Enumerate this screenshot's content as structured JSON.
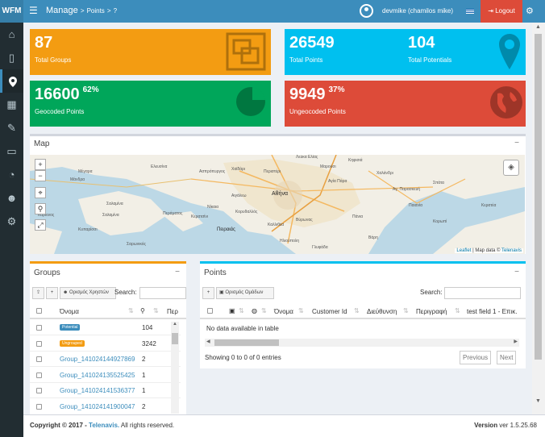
{
  "header": {
    "brand": "WFM",
    "title": "Manage",
    "crumb_sep1": ">",
    "crumb_item": "Points",
    "crumb_sep2": ">",
    "crumb_q": "?",
    "user": "devmike (chamilos mike)",
    "logout_label": "Logout"
  },
  "stats": {
    "groups": {
      "value": "87",
      "label": "Total Groups"
    },
    "points": {
      "value": "26549",
      "label": "Total Points"
    },
    "potentials": {
      "value": "104",
      "label": "Total Potentials"
    },
    "geocoded": {
      "value": "16600",
      "pct": "62%",
      "label": "Geocoded Points"
    },
    "ungeocoded": {
      "value": "9949",
      "pct": "37%",
      "label": "Ungeocoded Points"
    }
  },
  "map_panel": {
    "title": "Map",
    "minimize": "−",
    "zoom_in": "+",
    "zoom_out": "−",
    "attribution_leaflet": "Leaflet",
    "attribution_sep": " | Map data © ",
    "attribution_provider": "Telenavis",
    "labels": {
      "l1": "Λεύκα Ελίας",
      "l2": "Κηφισιά",
      "l3": "Σπάτα",
      "l4": "Μαρούσι",
      "l5": "Αγία Πάρα",
      "l6": "Χαϊδάρι",
      "l7": "Περιστέρι",
      "l8": "Αθήνα",
      "l9": "Αιγάλεω",
      "l10": "Κορυδαλλός",
      "l11": "Πειραιάς",
      "l12": "Νίκαια",
      "l13": "Σαλαμίνα",
      "l14": "Περάματος",
      "l15": "Καλλιθέα",
      "l16": "Βύρωνας",
      "l17": "Ηλιούπολη",
      "l18": "Γλυφάδα",
      "l19": "Κερατέα",
      "l20": "Σαρωνικός",
      "l21": "Μέγαρα",
      "l22": "Πάνια",
      "l23": "Κορωπί",
      "l24": "Παιανία",
      "l25": "Κερατσίνι",
      "l26": "Χαλάνδρι",
      "l27": "Βάρη",
      "l28": "Αγ. Παρασκευή",
      "l29": "Ελευσίνα",
      "l30": "Ασπρόπυργος",
      "l31": "Σαλαμίνα",
      "l32": "Μάνδρα",
      "l33": "Κάρκινος",
      "l34": "Κυπαρίσσι"
    }
  },
  "groups_panel": {
    "title": "Groups",
    "minimize": "−",
    "btn_assign": "Ορισμός Χρηστών",
    "search_label": "Search:",
    "columns": {
      "name": "Όνομα",
      "extra": "Περ"
    },
    "rows": [
      {
        "name": "Potential",
        "badge": true,
        "badge_color": "#3c8dbc",
        "count": "104"
      },
      {
        "name": "Ungrouped",
        "badge": true,
        "badge_color": "#f39c12",
        "count": "3242"
      },
      {
        "name": "Group_141024144927869",
        "badge": false,
        "count": "2"
      },
      {
        "name": "Group_141024135525425",
        "badge": false,
        "count": "1"
      },
      {
        "name": "Group_141024141536377",
        "badge": false,
        "count": "1"
      },
      {
        "name": "Group_141024141900047",
        "badge": false,
        "count": "2"
      }
    ]
  },
  "points_panel": {
    "title": "Points",
    "minimize": "−",
    "btn_assign": "Ορισμός Ομάδων",
    "search_label": "Search:",
    "columns": {
      "name": "Όνομα",
      "customer": "Customer Id",
      "address": "Διεύθυνση",
      "desc": "Περιγραφή",
      "field": "test field 1 - Επικ."
    },
    "empty": "No data available in table",
    "showing": "Showing 0 to 0 of 0 entries",
    "prev": "Previous",
    "next": "Next"
  },
  "footer": {
    "copyright": "Copyright © 2017 - ",
    "company": "Telenavis.",
    "rights": " All rights reserved.",
    "version_label": "Version",
    "version_value": " ver 1.5.25.68"
  }
}
